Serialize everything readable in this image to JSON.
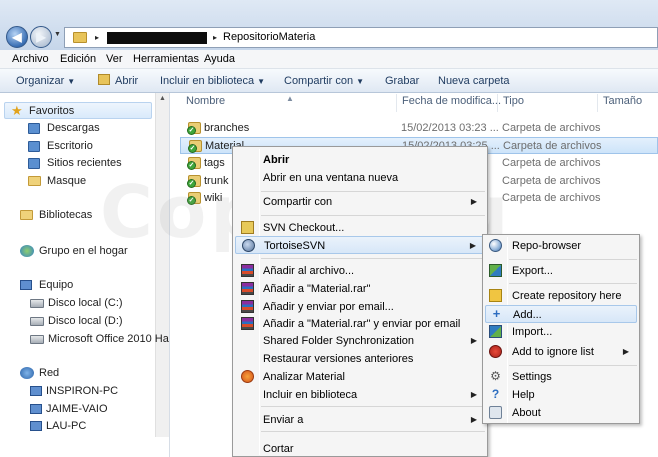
{
  "address": {
    "separator": "▸",
    "path_last": "RepositorioMateria"
  },
  "menubar": [
    "Archivo",
    "Edición",
    "Ver",
    "Herramientas",
    "Ayuda"
  ],
  "toolbar": {
    "organize": "Organizar",
    "open": "Abrir",
    "include": "Incluir en biblioteca",
    "share": "Compartir con",
    "burn": "Grabar",
    "new_folder": "Nueva carpeta"
  },
  "nav": {
    "favorites": "Favoritos",
    "downloads": "Descargas",
    "desktop": "Escritorio",
    "recent": "Sitios recientes",
    "masque": "Masque",
    "libraries": "Bibliotecas",
    "homegroup": "Grupo en el hogar",
    "computer": "Equipo",
    "disk_c": "Disco local (C:)",
    "disk_d": "Disco local (D:)",
    "office": "Microsoft Office 2010 Ha",
    "network": "Red",
    "pc1": "INSPIRON-PC",
    "pc2": "JAIME-VAIO",
    "pc3": "LAU-PC"
  },
  "columns": {
    "name": "Nombre",
    "date": "Fecha de modifica...",
    "type": "Tipo",
    "size": "Tamaño"
  },
  "files": [
    {
      "name": "branches",
      "date": "15/02/2013 03:23 ...",
      "type": "Carpeta de archivos"
    },
    {
      "name": "Material",
      "date": "15/02/2013 03:25 ...",
      "type": "Carpeta de archivos"
    },
    {
      "name": "tags",
      "date": "",
      "type": "Carpeta de archivos"
    },
    {
      "name": "trunk",
      "date": "",
      "type": "Carpeta de archivos"
    },
    {
      "name": "wiki",
      "date": "",
      "type": "Carpeta de archivos"
    }
  ],
  "watermark": "CopejaVu",
  "context": {
    "open": "Abrir",
    "open_new": "Abrir en una ventana nueva",
    "share": "Compartir con",
    "svn_checkout": "SVN Checkout...",
    "tortoise": "TortoiseSVN",
    "add_archive": "Añadir al archivo...",
    "add_rar": "Añadir a \"Material.rar\"",
    "add_email": "Añadir y enviar por email...",
    "add_rar_email": "Añadir a \"Material.rar\" y enviar por email",
    "shared_sync": "Shared Folder Synchronization",
    "restore": "Restaurar versiones anteriores",
    "scan": "Analizar Material",
    "include": "Incluir en biblioteca",
    "send_to": "Enviar a",
    "cut": "Cortar"
  },
  "submenu": {
    "repo_browser": "Repo-browser",
    "export": "Export...",
    "create_repo": "Create repository here",
    "add": "Add...",
    "import": "Import...",
    "ignore": "Add to ignore list",
    "settings": "Settings",
    "help": "Help",
    "about": "About"
  }
}
